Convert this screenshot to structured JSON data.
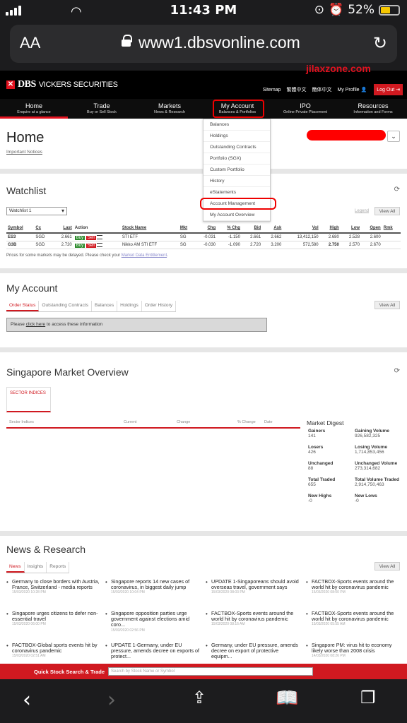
{
  "status_bar": {
    "time": "11:43 PM",
    "battery": "52%"
  },
  "browser": {
    "text_size": "AA",
    "url": "www1.dbsvonline.com"
  },
  "site": {
    "logo_text": "DBS",
    "logo_sub": "VICKERS SECURITIES",
    "watermark": "jilaxzone.com",
    "header_links": [
      "Sitemap",
      "繁體中文",
      "簡体中文",
      "My Profile",
      "Log Out"
    ]
  },
  "nav": [
    {
      "title": "Home",
      "sub": "Enquire at a glance"
    },
    {
      "title": "Trade",
      "sub": "Buy or Sell Stock"
    },
    {
      "title": "Markets",
      "sub": "News & Research"
    },
    {
      "title": "My Account",
      "sub": "Balances & Portfolios"
    },
    {
      "title": "IPO",
      "sub": "Online Private Placement"
    },
    {
      "title": "Resources",
      "sub": "Information and Forms"
    }
  ],
  "dropdown": [
    "Balances",
    "Holdings",
    "Outstanding Contracts",
    "Portfolio (SGX)",
    "Custom Portfolio",
    "History",
    "eStatements",
    "Account Management",
    "My Account Overview"
  ],
  "home": {
    "title": "Home",
    "notices": "Important Notices"
  },
  "watchlist": {
    "title": "Watchlist",
    "selected": "Watchlist 1",
    "legend": "Legend",
    "view_all": "View All",
    "columns": [
      "Symbol",
      "Cc",
      "Last",
      "Action",
      "Stock Name",
      "Mkt",
      "Chg",
      "% Chg",
      "Bid",
      "Ask",
      "Vol",
      "High",
      "Low",
      "Open",
      "Rmk"
    ],
    "rows": [
      {
        "symbol": "ES3",
        "cc": "SGD",
        "last": "2.661",
        "buy": "Buy",
        "sell": "Sell",
        "name": "STI ETF",
        "mkt": "SG",
        "chg": "-0.031",
        "pchg": "-1.150",
        "bid": "2.661",
        "ask": "2.662",
        "vol": "13,412,150",
        "high": "2.680",
        "low": "2.528",
        "open": "2.600",
        "rmk": ""
      },
      {
        "symbol": "G3B",
        "cc": "SGD",
        "last": "2.720",
        "buy": "Buy",
        "sell": "Sell",
        "name": "Nikko AM STI ETF",
        "mkt": "SG",
        "chg": "-0.030",
        "pchg": "-1.090",
        "bid": "2.720",
        "ask": "3.200",
        "vol": "572,580",
        "high": "2.750",
        "low": "2.570",
        "open": "2.670",
        "rmk": ""
      }
    ],
    "note": "Prices for some markets may be delayed. Please check your",
    "note_link": "Market Data Entitlement",
    "note_end": "."
  },
  "my_account": {
    "title": "My Account",
    "tabs": [
      "Order Status",
      "Outstanding Contracts",
      "Balances",
      "Holdings",
      "Order History"
    ],
    "view_all": "View All",
    "msg_pre": "Please",
    "msg_link": "click here",
    "msg_post": "to access these information"
  },
  "market_overview": {
    "title": "Singapore Market Overview",
    "tab": "SECTOR INDICES",
    "columns": [
      "Sector Indices",
      "Current",
      "Change",
      "% Change",
      "Date"
    ],
    "digest_title": "Market Digest",
    "digest": [
      {
        "label": "Gainers",
        "value": "141"
      },
      {
        "label": "Gaining Volume",
        "value": "926,582,325"
      },
      {
        "label": "Losers",
        "value": "426"
      },
      {
        "label": "Losing Volume",
        "value": "1,714,853,456"
      },
      {
        "label": "Unchanged",
        "value": "88"
      },
      {
        "label": "Unchanged Volume",
        "value": "273,314,682"
      },
      {
        "label": "Total Traded",
        "value": "655"
      },
      {
        "label": "Total Volume Traded",
        "value": "2,914,750,463"
      },
      {
        "label": "New Highs",
        "value": "-0"
      },
      {
        "label": "New Lows",
        "value": "-0"
      }
    ]
  },
  "news": {
    "title": "News & Research",
    "tabs": [
      "News",
      "Insights",
      "Reports"
    ],
    "view_all": "View All",
    "columns": [
      [
        {
          "headline": "Germany to close borders with Austria, France, Switzerland - media reports",
          "date": "15/03/2020 10:28 PM"
        },
        {
          "headline": "Singapore urges citizens to defer non-essential travel",
          "date": "15/03/2020 06:00 PM"
        },
        {
          "headline": "FACTBOX-Global sports events hit by coronavirus pandemic",
          "date": "15/03/2020 02:51 AM"
        }
      ],
      [
        {
          "headline": "Singapore reports 14 new cases of coronavirus, in biggest daily jump",
          "date": "15/03/2020 10:04 PM"
        },
        {
          "headline": "Singapore opposition parties urge government against elections amid coro...",
          "date": "15/03/2020 02:56 PM"
        },
        {
          "headline": "UPDATE 1-Germany, under EU pressure, amends decree on exports of protect...",
          "date": ""
        }
      ],
      [
        {
          "headline": "UPDATE 1-Singaporeans should avoid overseas travel, government says",
          "date": "15/03/2020 08:03 PM"
        },
        {
          "headline": "FACTBOX-Sports events around the world hit by coronavirus pandemic",
          "date": "15/03/2020 08:16 AM"
        },
        {
          "headline": "Germany, under EU pressure, amends decree on export of protective equipm...",
          "date": ""
        }
      ],
      [
        {
          "headline": "FACTBOX-Sports events around the world hit by coronavirus pandemic",
          "date": "15/03/2020 08:00 PM"
        },
        {
          "headline": "FACTBOX-Sports events around the world hit by coronavirus pandemic",
          "date": "15/03/2020 05:55 AM"
        },
        {
          "headline": "Singapore PM: virus hit to economy likely worse than 2008 crisis",
          "date": "14/03/2020 08:26 PM"
        }
      ]
    ]
  },
  "quick_search": {
    "label": "Quick Stock Search & Trade",
    "placeholder": "Search by Stock Name or Symbol"
  }
}
